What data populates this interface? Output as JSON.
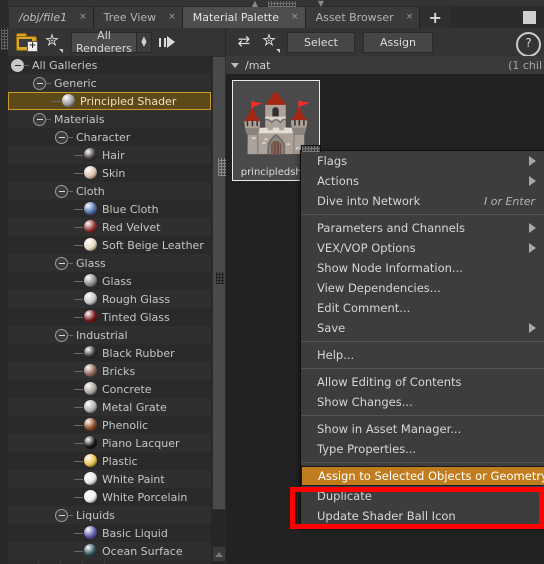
{
  "window": {
    "tabs": [
      {
        "label": "/obj/file1",
        "active": false,
        "italic": true,
        "close": "×"
      },
      {
        "label": "Tree View",
        "active": false,
        "close": "×"
      },
      {
        "label": "Material Palette",
        "active": true,
        "close": "×"
      },
      {
        "label": "Asset Browser",
        "active": false,
        "close": "×"
      }
    ],
    "new_tab_label": "+"
  },
  "left_toolbar": {
    "new_folder_icon": "folder-add-icon",
    "gear_icon": "gear-icon",
    "renderer_value": "All Renderers",
    "renderer_options": [
      "All Renderers"
    ],
    "expand_icon": "arrow-out-icon"
  },
  "right_toolbar": {
    "refresh_icon": "refresh-icon",
    "gear_icon": "gear-icon",
    "select_label": "Select",
    "assign_label": "Assign",
    "help_icon": "help-icon",
    "help_glyph": "?"
  },
  "path_bar": {
    "path": "/mat",
    "child_count": "(1 chil"
  },
  "gallery": {
    "items": [
      {
        "name": "principledsh...",
        "thumb_icon": "castle-icon",
        "thumb_glyph": "🏰",
        "selected": true
      }
    ]
  },
  "tree": {
    "rows": [
      {
        "label": "All Galleries",
        "depth": 0,
        "expander": "collapse-root",
        "sphere": null
      },
      {
        "label": "Generic",
        "depth": 1,
        "expander": "collapse",
        "sphere": null
      },
      {
        "label": "Principled Shader",
        "depth": 2,
        "expander": null,
        "sphere": "#9a9a9a",
        "selected": true
      },
      {
        "label": "Materials",
        "depth": 1,
        "expander": "collapse",
        "sphere": null
      },
      {
        "label": "Character",
        "depth": 2,
        "expander": "collapse",
        "sphere": null
      },
      {
        "label": "Hair",
        "depth": 3,
        "expander": null,
        "sphere": "#3a3232"
      },
      {
        "label": "Skin",
        "depth": 3,
        "expander": null,
        "sphere": "#d9bfae"
      },
      {
        "label": "Cloth",
        "depth": 2,
        "expander": "collapse",
        "sphere": null
      },
      {
        "label": "Blue Cloth",
        "depth": 3,
        "expander": null,
        "sphere": "#4a6fa8"
      },
      {
        "label": "Red Velvet",
        "depth": 3,
        "expander": null,
        "sphere": "#8f2b2b"
      },
      {
        "label": "Soft Beige Leather",
        "depth": 3,
        "expander": null,
        "sphere": "#e4d9bf"
      },
      {
        "label": "Glass",
        "depth": 2,
        "expander": "collapse",
        "sphere": null
      },
      {
        "label": "Glass",
        "depth": 3,
        "expander": null,
        "sphere": "#8a8a8a"
      },
      {
        "label": "Rough Glass",
        "depth": 3,
        "expander": null,
        "sphere": "#c4c4c4"
      },
      {
        "label": "Tinted Glass",
        "depth": 3,
        "expander": null,
        "sphere": "#7a1414"
      },
      {
        "label": "Industrial",
        "depth": 2,
        "expander": "collapse",
        "sphere": null
      },
      {
        "label": "Black Rubber",
        "depth": 3,
        "expander": null,
        "sphere": "#2b2b2b"
      },
      {
        "label": "Bricks",
        "depth": 3,
        "expander": null,
        "sphere": "#8a6256"
      },
      {
        "label": "Concrete",
        "depth": 3,
        "expander": null,
        "sphere": "#a8a49c"
      },
      {
        "label": "Metal Grate",
        "depth": 3,
        "expander": null,
        "sphere": "#b0b0ac"
      },
      {
        "label": "Phenolic",
        "depth": 3,
        "expander": null,
        "sphere": "#8a4a22"
      },
      {
        "label": "Piano Lacquer",
        "depth": 3,
        "expander": null,
        "sphere": "#141414"
      },
      {
        "label": "Plastic",
        "depth": 3,
        "expander": null,
        "sphere": "#e6c24a"
      },
      {
        "label": "White Paint",
        "depth": 3,
        "expander": null,
        "sphere": "#e8e8e8"
      },
      {
        "label": "White Porcelain",
        "depth": 3,
        "expander": null,
        "sphere": "#f0f0f0"
      },
      {
        "label": "Liquids",
        "depth": 2,
        "expander": "collapse",
        "sphere": null
      },
      {
        "label": "Basic Liquid",
        "depth": 3,
        "expander": null,
        "sphere": "#5a5aa8"
      },
      {
        "label": "Ocean Surface",
        "depth": 3,
        "expander": null,
        "sphere": "#2a4a52"
      }
    ]
  },
  "context_menu": {
    "groups": [
      [
        {
          "label": "Flags",
          "submenu": true
        },
        {
          "label": "Actions",
          "submenu": true
        },
        {
          "label": "Dive into Network",
          "shortcut": "I or Enter"
        }
      ],
      [
        {
          "label": "Parameters and Channels",
          "submenu": true
        },
        {
          "label": "VEX/VOP Options",
          "submenu": true
        },
        {
          "label": "Show Node Information..."
        },
        {
          "label": "View Dependencies..."
        },
        {
          "label": "Edit Comment..."
        },
        {
          "label": "Save",
          "submenu": true
        }
      ],
      [
        {
          "label": "Help..."
        }
      ],
      [
        {
          "label": "Allow Editing of Contents"
        },
        {
          "label": "Show Changes..."
        }
      ],
      [
        {
          "label": "Show in Asset Manager..."
        },
        {
          "label": "Type Properties..."
        }
      ],
      [
        {
          "label": "Assign to Selected Objects or Geometry",
          "highlighted": true
        },
        {
          "label": "Duplicate"
        },
        {
          "label": "Update Shader Ball Icon"
        }
      ]
    ],
    "highlight_color": "#c07d1e",
    "annotation_color": "#ff0000"
  }
}
